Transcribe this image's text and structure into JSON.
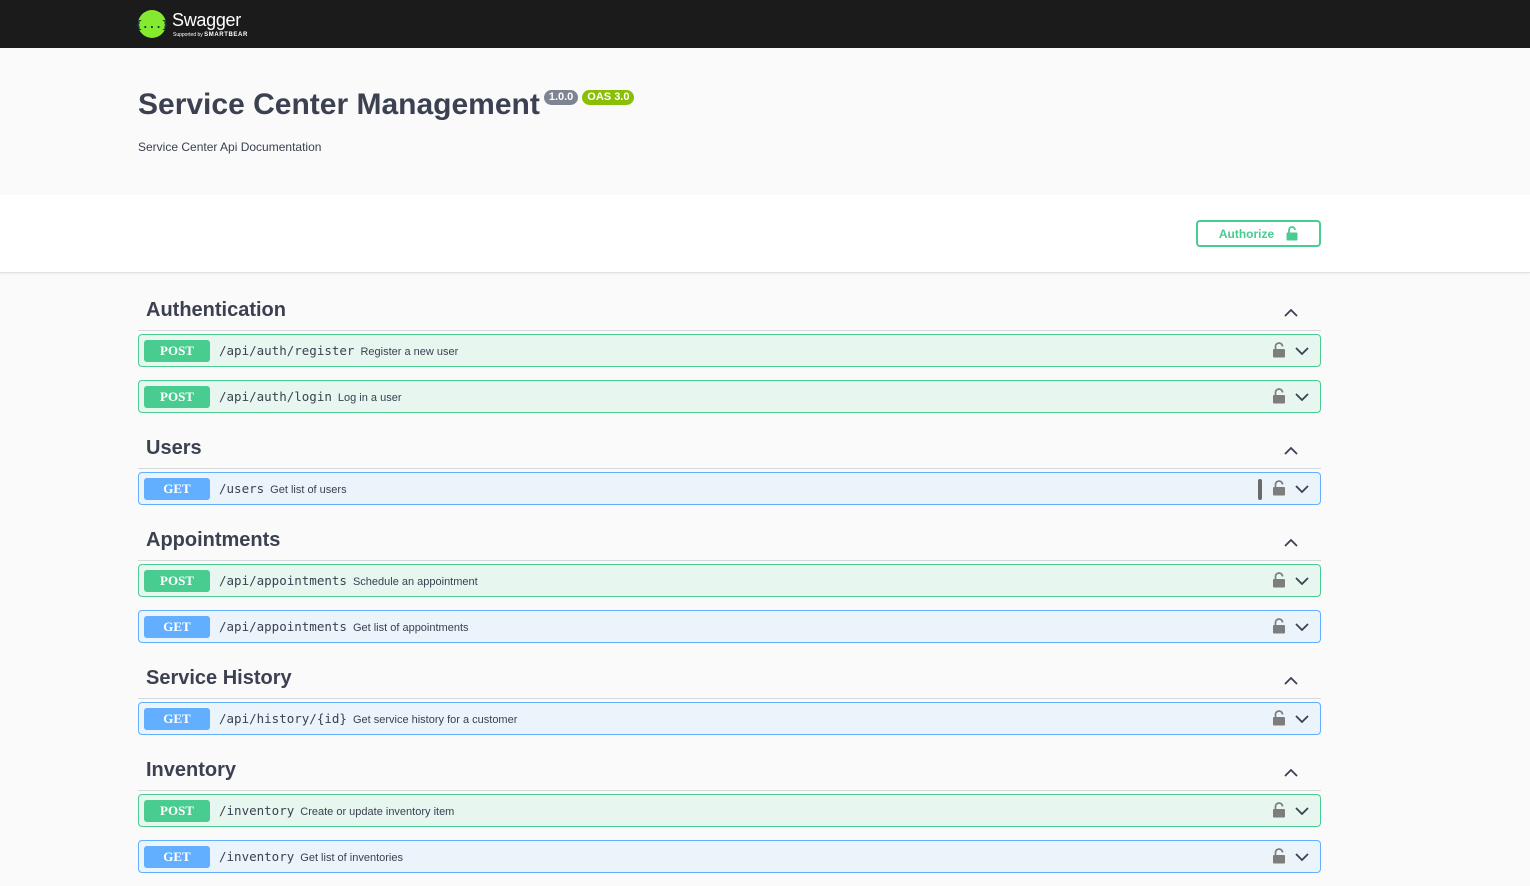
{
  "topbar": {
    "logo_glyph": "{...}",
    "logo_name": "Swagger",
    "logo_sub_prefix": "Supported by",
    "logo_sub_brand": "SMARTBEAR"
  },
  "info": {
    "title": "Service Center Management",
    "version": "1.0.0",
    "oas": "OAS 3.0",
    "description": "Service Center Api Documentation"
  },
  "scheme": {
    "authorize_label": "Authorize"
  },
  "tags": [
    {
      "name": "Authentication",
      "ops": [
        {
          "method": "POST",
          "path": "/api/auth/register",
          "summary": "Register a new user"
        },
        {
          "method": "POST",
          "path": "/api/auth/login",
          "summary": "Log in a user"
        }
      ]
    },
    {
      "name": "Users",
      "ops": [
        {
          "method": "GET",
          "path": "/users",
          "summary": "Get list of users"
        }
      ]
    },
    {
      "name": "Appointments",
      "ops": [
        {
          "method": "POST",
          "path": "/api/appointments",
          "summary": "Schedule an appointment"
        },
        {
          "method": "GET",
          "path": "/api/appointments",
          "summary": "Get list of appointments"
        }
      ]
    },
    {
      "name": "Service History",
      "ops": [
        {
          "method": "GET",
          "path": "/api/history/{id}",
          "summary": "Get service history for a customer"
        }
      ]
    },
    {
      "name": "Inventory",
      "ops": [
        {
          "method": "POST",
          "path": "/inventory",
          "summary": "Create or update inventory item"
        },
        {
          "method": "GET",
          "path": "/inventory",
          "summary": "Get list of inventories"
        }
      ]
    }
  ],
  "colors": {
    "post": "#49cc90",
    "get": "#61affe",
    "topbar": "#1b1b1b",
    "logo": "#85ea2d"
  },
  "icons": {
    "tag_toggle": "chevron-up-icon",
    "op_lock": "lock-icon",
    "op_toggle": "chevron-down-icon"
  }
}
